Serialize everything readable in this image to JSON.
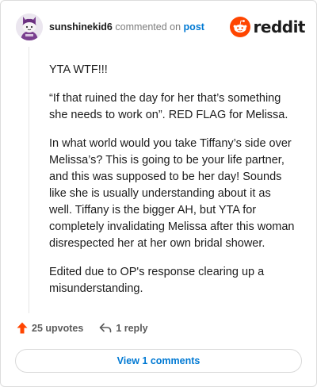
{
  "header": {
    "username": "sunshinekid6",
    "action": "commented on",
    "link": "post",
    "brand": "reddit"
  },
  "comment": {
    "paragraphs": [
      "YTA WTF!!!",
      "“If that ruined the day for her that’s something she needs to work on”. RED FLAG for Melissa.",
      "In what world would you take Tiffany’s side over Melissa’s? This is going to be your life partner, and this was supposed to be her day! Sounds like she is usually understanding about it as well. Tiffany is the bigger AH, but YTA for completely invalidating Melissa after this woman disrespected her at her own bridal shower.",
      "Edited due to OP's response clearing up a misunderstanding."
    ]
  },
  "footer": {
    "upvotes": "25 upvotes",
    "reply": "1 reply",
    "view_comments": "View 1 comments"
  },
  "colors": {
    "brand": "#ff4500",
    "link": "#0079d3"
  },
  "icons": {
    "upvote": "upvote-arrow-icon",
    "reply": "reply-arrow-icon",
    "logo": "reddit-snoo-icon"
  }
}
